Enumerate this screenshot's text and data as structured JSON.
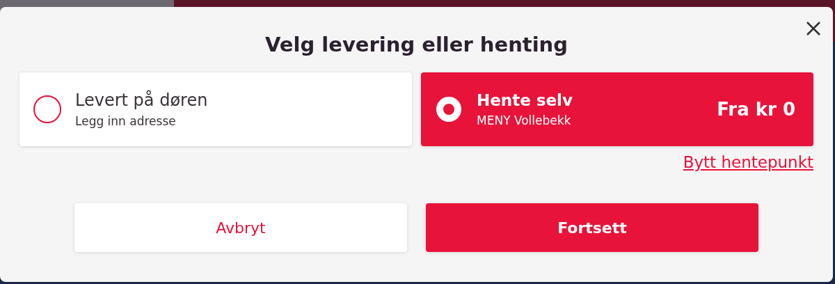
{
  "dialog": {
    "title": "Velg levering eller henting",
    "options": [
      {
        "title": "Levert på døren",
        "subtitle": "Legg inn adresse",
        "selected": false
      },
      {
        "title": "Hente selv",
        "subtitle": "MENY Vollebekk",
        "price": "Fra kr 0",
        "selected": true
      }
    ],
    "link": "Bytt hentepunkt",
    "buttons": [
      {
        "label": "Avbryt",
        "kind": "secondary"
      },
      {
        "label": "Fortsett",
        "kind": "primary"
      }
    ]
  }
}
